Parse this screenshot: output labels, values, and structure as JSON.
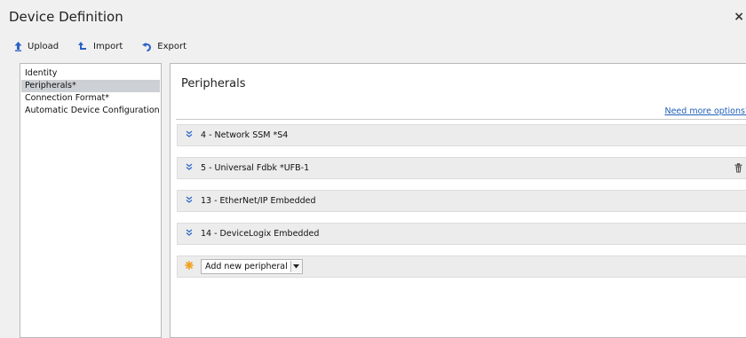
{
  "window": {
    "title": "Device Definition",
    "close_label": "×"
  },
  "toolbar": {
    "upload_label": "Upload",
    "import_label": "Import",
    "export_label": "Export"
  },
  "nav": {
    "items": [
      {
        "label": "Identity"
      },
      {
        "label": "Peripherals*"
      },
      {
        "label": "Connection Format*"
      },
      {
        "label": "Automatic Device Configuration"
      }
    ],
    "selected": "Peripherals*"
  },
  "main": {
    "title": "Peripherals",
    "more_options_link": "Need more options?",
    "peripherals": [
      {
        "label": "4 - Network SSM *S4"
      },
      {
        "label": "5 - Universal Fdbk *UFB-1"
      },
      {
        "label": "13 - EtherNet/IP Embedded"
      },
      {
        "label": "14 - DeviceLogix Embedded"
      }
    ],
    "add_peripheral_value": "Add new peripheral"
  },
  "colors": {
    "accent_blue": "#2a62c8",
    "link": "#1f5fb8",
    "add_star": "#f0a020",
    "row_background": "#ececec"
  }
}
